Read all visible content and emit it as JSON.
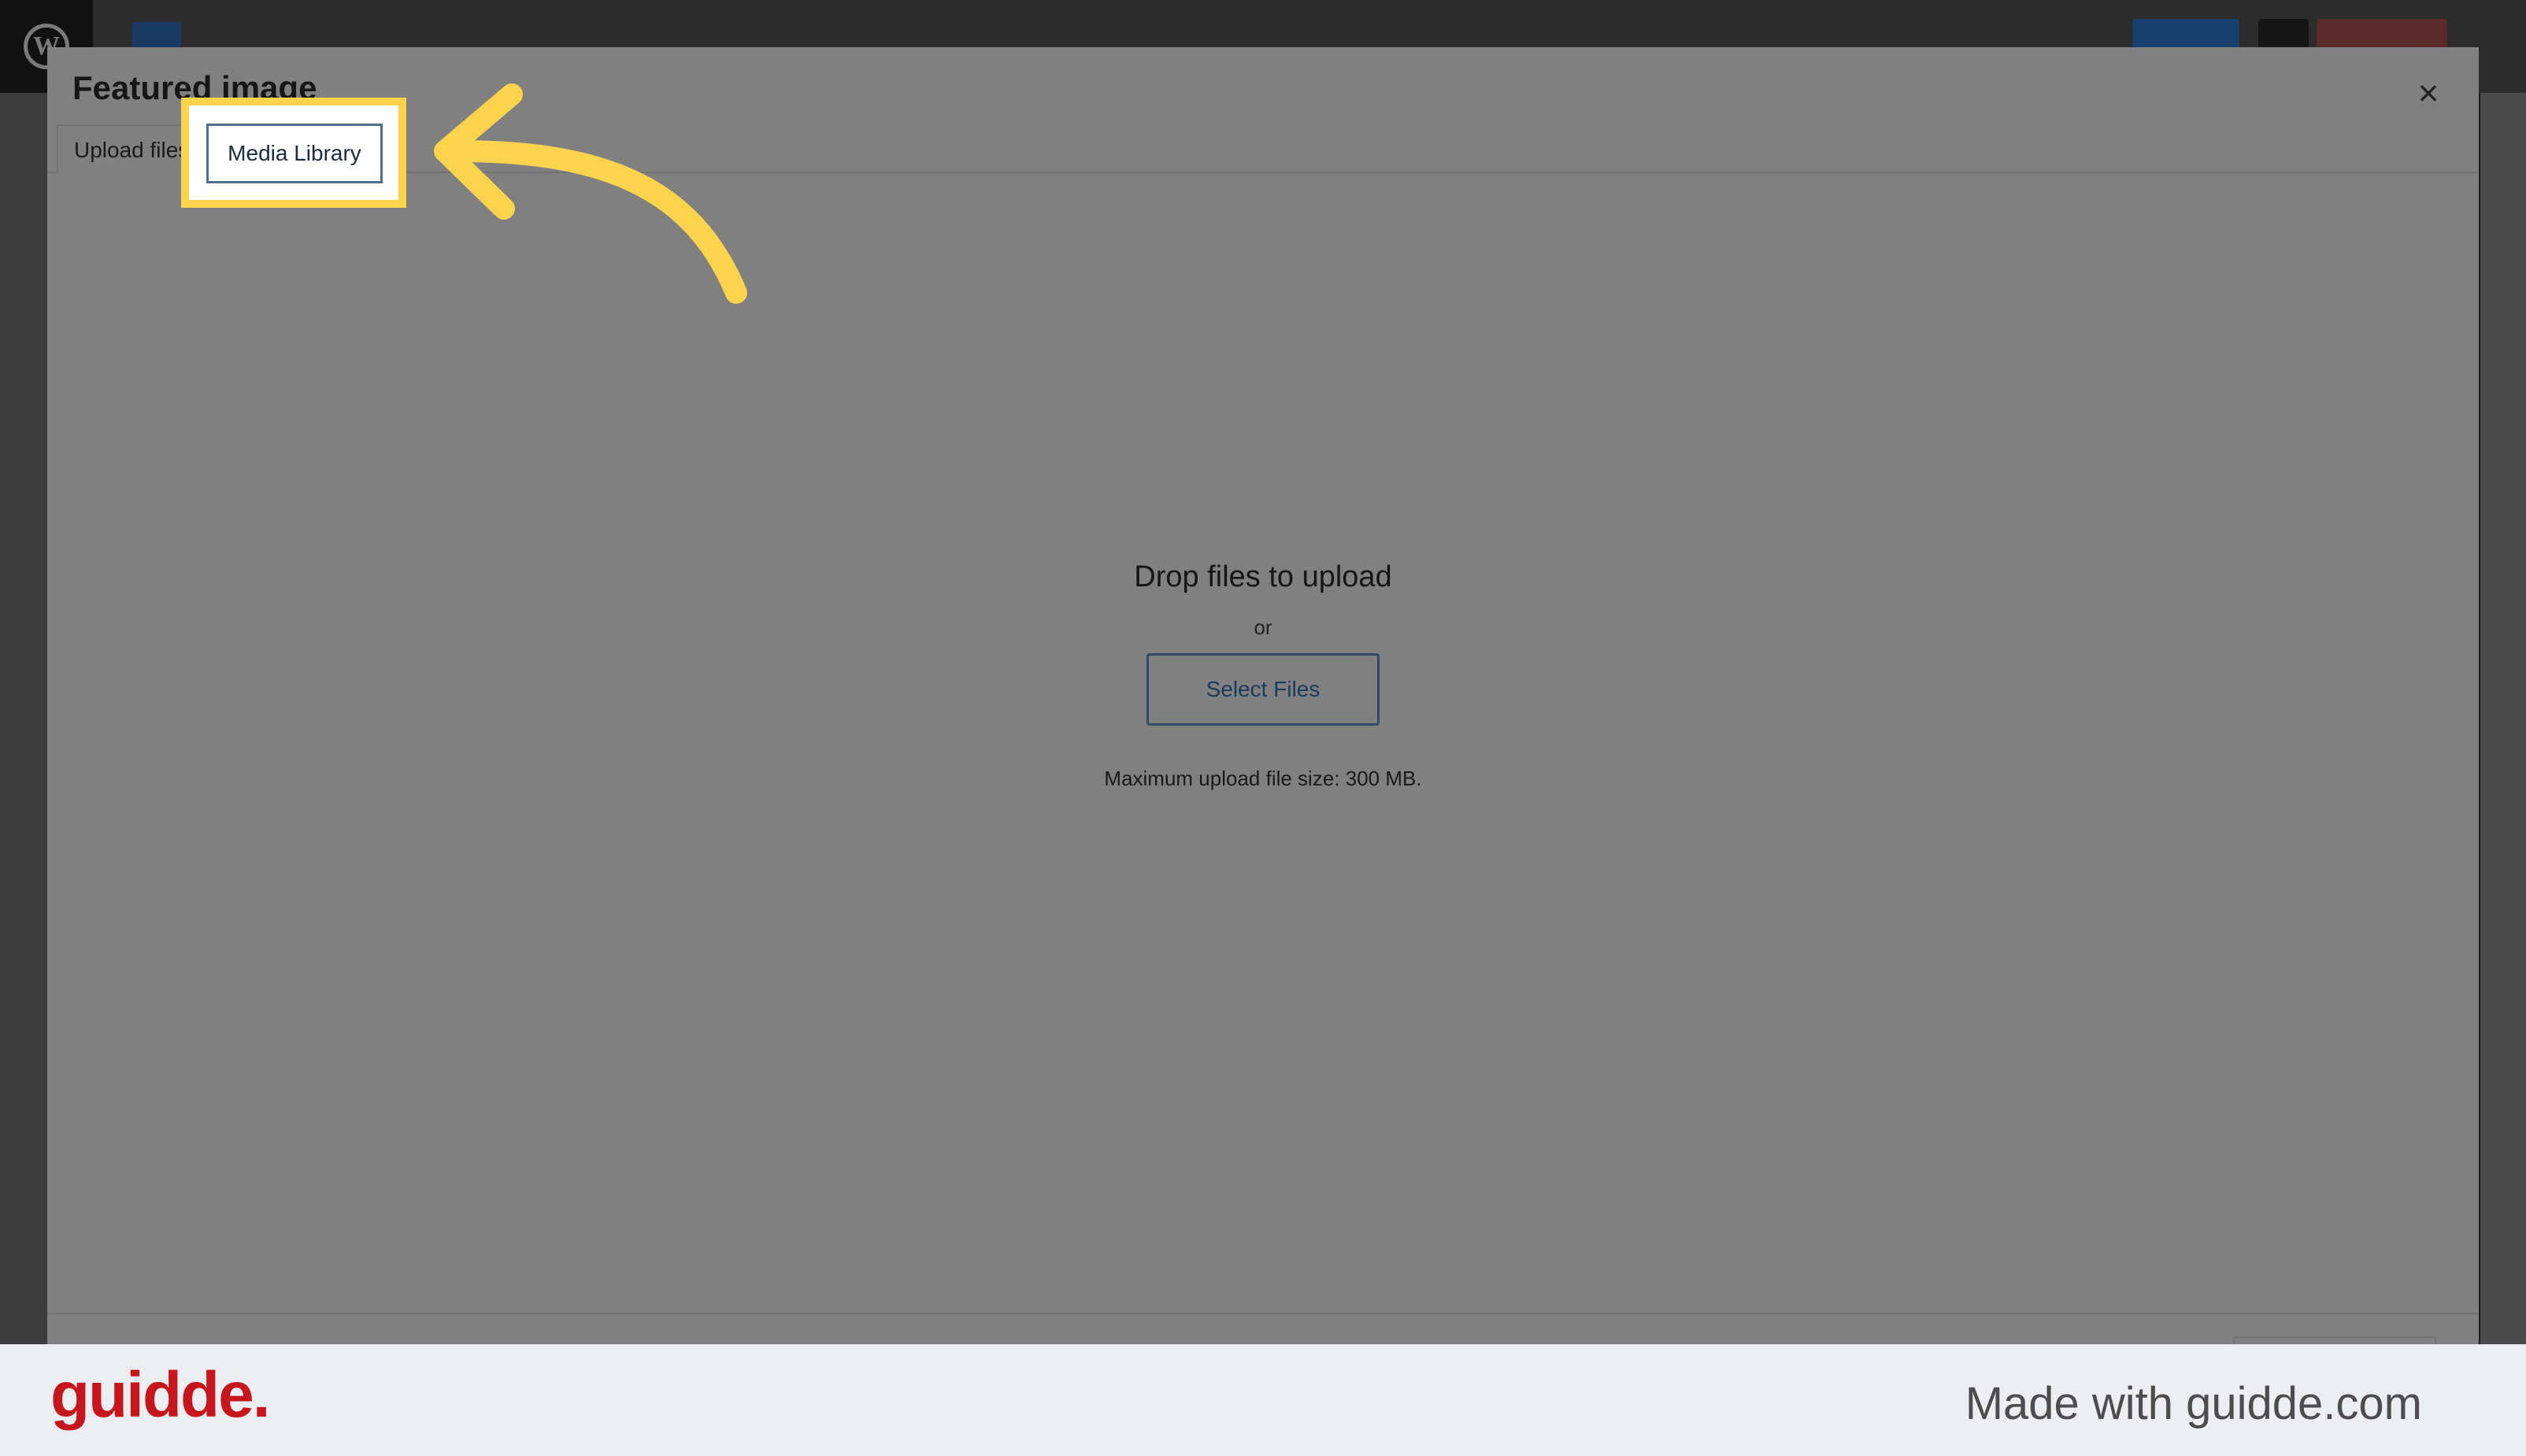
{
  "modal": {
    "title": "Featured image",
    "close_glyph": "×",
    "tabs": [
      {
        "label": "Upload files",
        "active": false
      },
      {
        "label": "Media Library",
        "active": false,
        "highlighted": true
      }
    ],
    "dropzone": {
      "heading": "Drop files to upload",
      "or": "or",
      "select_button": "Select Files",
      "max_size": "Maximum upload file size: 300 MB."
    }
  },
  "footer": {
    "brand": "guidde.",
    "tagline": "Made with guidde.com"
  },
  "colors": {
    "highlight": "#fcd34d",
    "brand_red": "#c4161c",
    "overlay": "#808080"
  },
  "icons": [
    "wordpress-logo-icon",
    "close-icon",
    "curved-arrow-icon"
  ]
}
